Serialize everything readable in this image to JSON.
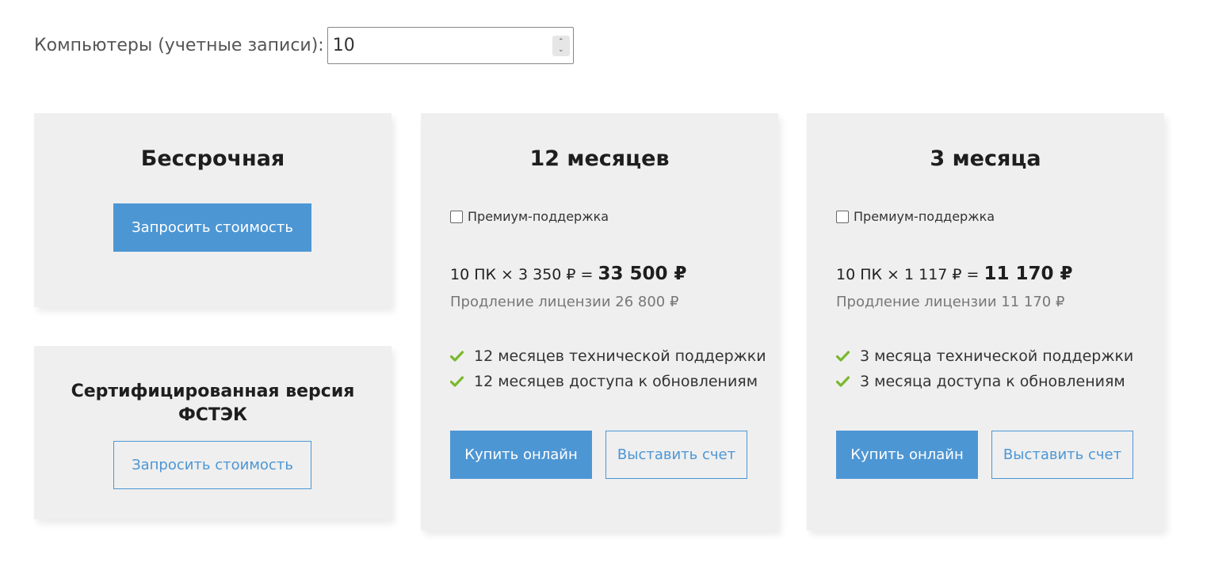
{
  "quantity": {
    "label": "Компьютеры (учетные записи):",
    "value": "10"
  },
  "perpetual": {
    "title": "Бессрочная",
    "button": "Запросить стоимость"
  },
  "certified": {
    "title_line1": "Сертифицированная версия",
    "title_line2": "ФСТЭК",
    "button": "Запросить стоимость"
  },
  "plans": [
    {
      "title": "12 месяцев",
      "premium_label": "Премиум-поддержка",
      "price_formula": "10 ПК × 3 350 ₽ = ",
      "price_total": "33 500 ₽",
      "renewal": "Продление лицензии 26 800 ₽",
      "features": [
        "12 месяцев технической поддержки",
        "12 месяцев доступа к обновлениям"
      ],
      "buy_label": "Купить онлайн",
      "invoice_label": "Выставить счет"
    },
    {
      "title": "3 месяца",
      "premium_label": "Премиум-поддержка",
      "price_formula": "10 ПК × 1 117 ₽ = ",
      "price_total": "11 170 ₽",
      "renewal": "Продление лицензии 11 170 ₽",
      "features": [
        "3 месяца технической поддержки",
        "3 месяца доступа к обновлениям"
      ],
      "buy_label": "Купить онлайн",
      "invoice_label": "Выставить счет"
    }
  ],
  "colors": {
    "accent": "#4d96d4",
    "check": "#7ab82e",
    "card_bg": "#efefef"
  }
}
